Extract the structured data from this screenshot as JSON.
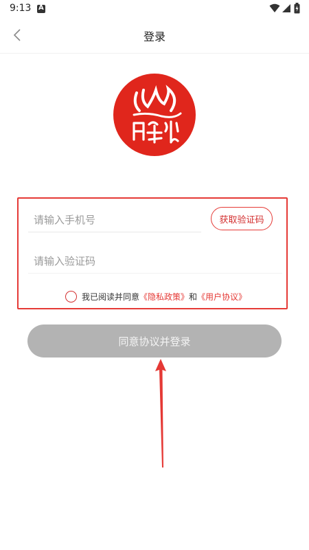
{
  "status_bar": {
    "time": "9:13"
  },
  "nav": {
    "title": "登录"
  },
  "form": {
    "phone_placeholder": "请输入手机号",
    "code_button_label": "获取验证码",
    "code_placeholder": "请输入验证码",
    "agreement": {
      "prefix": "我已阅读并同意",
      "privacy_link": "《隐私政策》",
      "conjunction": "和",
      "terms_link": "《用户协议》"
    }
  },
  "login_button_label": "同意协议并登录",
  "colors": {
    "accent": "#e53935",
    "button_disabled": "#b3b3b3",
    "logo_red": "#e0261c"
  }
}
